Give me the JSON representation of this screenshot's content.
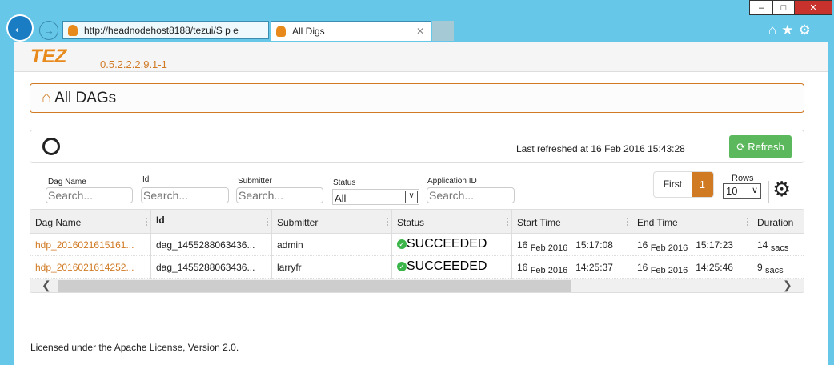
{
  "browser": {
    "window_controls": {
      "minimize": "–",
      "maximize": "□",
      "close": "✕"
    },
    "address": "http://headnodehost8188/tezui/S p e",
    "tab_title": "All Digs",
    "tab_close": "✕",
    "toolbar_icons": [
      "home-icon",
      "star-icon",
      "gear-icon"
    ]
  },
  "app": {
    "logo": "TEZ",
    "version": "0.5.2.2.2.9.1-1"
  },
  "page_title": "All DAGs",
  "refresh_bar": {
    "last_refreshed": "Last refreshed at 16 Feb 2016 15:43:28",
    "refresh_label": "Refresh"
  },
  "filters": [
    {
      "label": "Dag Name",
      "placeholder": "Search..."
    },
    {
      "label": "Id",
      "placeholder": "Search..."
    },
    {
      "label": "Submitter",
      "placeholder": "Search..."
    },
    {
      "label": "Status",
      "value": "All"
    },
    {
      "label": "Application ID",
      "placeholder": "Search..."
    }
  ],
  "pagination": {
    "first": "First",
    "current": "1",
    "rows_label": "Rows",
    "rows_value": "10"
  },
  "colors": {
    "accent": "#d07a24",
    "success": "#5cb85c",
    "browser": "#66c7e9"
  },
  "table": {
    "columns": [
      "Dag Name",
      "Id",
      "Submitter",
      "Status",
      "Start Time",
      "End Time",
      "Duration"
    ],
    "rows": [
      {
        "dag_name": "hdp_2016021615161...",
        "id": "dag_1455288063436...",
        "submitter": "admin",
        "status": "SUCCEEDED",
        "start_day": "16",
        "start_date": "Feb 2016",
        "start_time": "15:17:08",
        "end_day": "16",
        "end_date": "Feb 2016",
        "end_time": "15:17:23",
        "duration": "14",
        "duration_unit": "sacs"
      },
      {
        "dag_name": "hdp_2016021614252...",
        "id": "dag_1455288063436...",
        "submitter": "larryfr",
        "status": "SUCCEEDED",
        "start_day": "16",
        "start_date": "Feb 2016",
        "start_time": "14:25:37",
        "end_day": "16",
        "end_date": "Feb 2016",
        "end_time": "14:25:46",
        "duration": "9",
        "duration_unit": "sacs"
      }
    ]
  },
  "footer": "Licensed under the Apache License, Version 2.0."
}
